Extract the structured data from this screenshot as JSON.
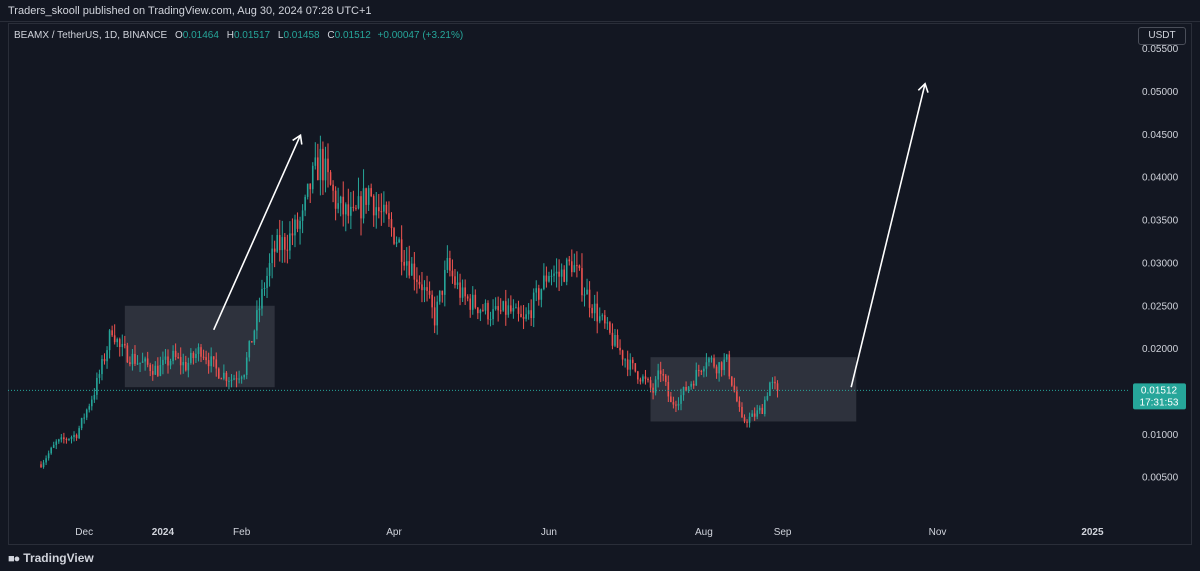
{
  "header": {
    "publisher_line": "Traders_skooll published on TradingView.com, Aug 30, 2024 07:28 UTC+1"
  },
  "legend": {
    "symbol": "BEAMX / TetherUS, 1D, BINANCE",
    "o_label": "O",
    "o_value": "0.01464",
    "h_label": "H",
    "h_value": "0.01517",
    "l_label": "L",
    "l_value": "0.01458",
    "c_label": "C",
    "c_value": "0.01512",
    "change": "+0.00047 (+3.21%)"
  },
  "currency_button": "USDT",
  "price_tag": {
    "price": "0.01512",
    "countdown": "17:31:53"
  },
  "footer": {
    "brand": "TradingView"
  },
  "colors": {
    "background": "#131722",
    "up": "#26a69a",
    "down": "#ef5350",
    "price_tag": "#26a69a",
    "axis_text": "#d1d4dc"
  },
  "chart_data": {
    "type": "candlestick",
    "y_ticks": [
      "0.05500",
      "0.05000",
      "0.04500",
      "0.04000",
      "0.03500",
      "0.03000",
      "0.02500",
      "0.02000",
      "0.01000",
      "0.00500"
    ],
    "ylim": [
      0.0,
      0.058
    ],
    "x_ticks": [
      "Dec",
      "2024",
      "Feb",
      "Apr",
      "Jun",
      "Aug",
      "Sep",
      "Nov",
      "2025"
    ],
    "x_range": [
      "2023-11-01",
      "2025-01-15"
    ],
    "x_tick_dates": [
      "2023-12-01",
      "2024-01-01",
      "2024-02-01",
      "2024-04-01",
      "2024-06-01",
      "2024-08-01",
      "2024-09-01",
      "2024-11-01",
      "2025-01-01"
    ],
    "last_price": 0.01512,
    "price_series": [
      [
        "2023-11-14",
        0.0065
      ],
      [
        "2023-11-20",
        0.009
      ],
      [
        "2023-11-28",
        0.01
      ],
      [
        "2023-12-05",
        0.015
      ],
      [
        "2023-12-09",
        0.019
      ],
      [
        "2023-12-12",
        0.0225
      ],
      [
        "2023-12-15",
        0.02
      ],
      [
        "2023-12-22",
        0.0185
      ],
      [
        "2023-12-30",
        0.0175
      ],
      [
        "2024-01-05",
        0.019
      ],
      [
        "2024-01-10",
        0.018
      ],
      [
        "2024-01-16",
        0.02
      ],
      [
        "2024-01-22",
        0.0175
      ],
      [
        "2024-01-28",
        0.0165
      ],
      [
        "2024-02-02",
        0.0175
      ],
      [
        "2024-02-07",
        0.0235
      ],
      [
        "2024-02-10",
        0.0275
      ],
      [
        "2024-02-14",
        0.0315
      ],
      [
        "2024-02-20",
        0.033
      ],
      [
        "2024-02-25",
        0.035
      ],
      [
        "2024-02-28",
        0.039
      ],
      [
        "2024-03-03",
        0.042
      ],
      [
        "2024-03-06",
        0.0395
      ],
      [
        "2024-03-10",
        0.0365
      ],
      [
        "2024-03-16",
        0.035
      ],
      [
        "2024-03-22",
        0.0385
      ],
      [
        "2024-03-26",
        0.036
      ],
      [
        "2024-04-01",
        0.0335
      ],
      [
        "2024-04-06",
        0.0305
      ],
      [
        "2024-04-12",
        0.0275
      ],
      [
        "2024-04-17",
        0.0235
      ],
      [
        "2024-04-22",
        0.0295
      ],
      [
        "2024-04-28",
        0.026
      ],
      [
        "2024-05-04",
        0.025
      ],
      [
        "2024-05-10",
        0.024
      ],
      [
        "2024-05-16",
        0.0245
      ],
      [
        "2024-05-22",
        0.023
      ],
      [
        "2024-05-28",
        0.0265
      ],
      [
        "2024-06-01",
        0.029
      ],
      [
        "2024-06-05",
        0.0285
      ],
      [
        "2024-06-10",
        0.03
      ],
      [
        "2024-06-14",
        0.0275
      ],
      [
        "2024-06-20",
        0.024
      ],
      [
        "2024-06-26",
        0.021
      ],
      [
        "2024-07-03",
        0.018
      ],
      [
        "2024-07-08",
        0.0165
      ],
      [
        "2024-07-12",
        0.015
      ],
      [
        "2024-07-15",
        0.0175
      ],
      [
        "2024-07-19",
        0.0135
      ],
      [
        "2024-07-23",
        0.0145
      ],
      [
        "2024-07-28",
        0.0165
      ],
      [
        "2024-08-02",
        0.019
      ],
      [
        "2024-08-06",
        0.018
      ],
      [
        "2024-08-10",
        0.0185
      ],
      [
        "2024-08-13",
        0.015
      ],
      [
        "2024-08-16",
        0.0115
      ],
      [
        "2024-08-20",
        0.012
      ],
      [
        "2024-08-24",
        0.013
      ],
      [
        "2024-08-27",
        0.016
      ],
      [
        "2024-08-30",
        0.0151
      ]
    ],
    "annotations": {
      "consolidation_boxes": [
        {
          "from": "2023-12-17",
          "to": "2024-02-14",
          "low": 0.0155,
          "high": 0.025
        },
        {
          "from": "2024-07-11",
          "to": "2024-09-30",
          "low": 0.0115,
          "high": 0.019
        }
      ],
      "arrows": [
        {
          "from_date": "2024-01-21",
          "from_price": 0.0222,
          "to_date": "2024-02-24",
          "to_price": 0.0448
        },
        {
          "from_date": "2024-09-28",
          "from_price": 0.0155,
          "to_date": "2024-10-27",
          "to_price": 0.0508
        }
      ]
    }
  }
}
